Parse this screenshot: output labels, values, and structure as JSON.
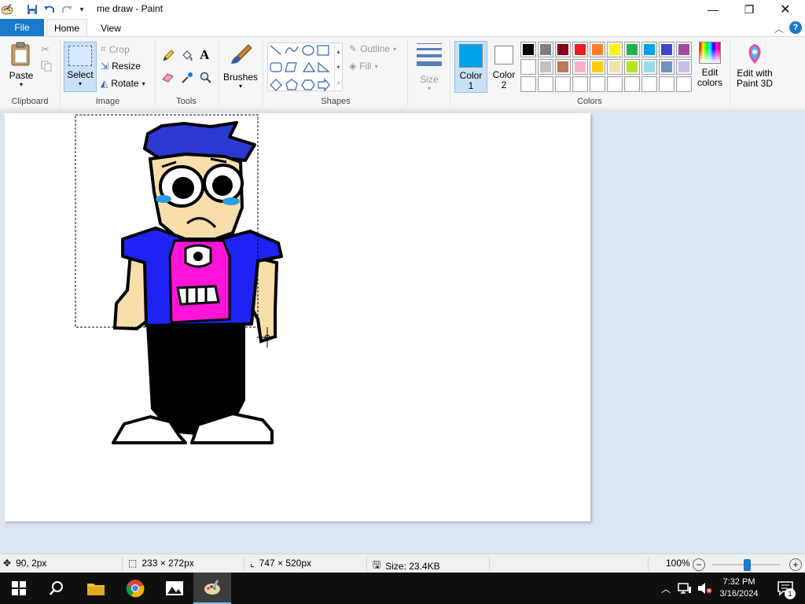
{
  "window": {
    "title": "me draw - Paint"
  },
  "menu": {
    "file": "File",
    "home": "Home",
    "view": "View"
  },
  "clipboard": {
    "paste": "Paste",
    "label": "Clipboard"
  },
  "image": {
    "select": "Select",
    "crop": "Crop",
    "resize": "Resize",
    "rotate": "Rotate",
    "label": "Image"
  },
  "tools": {
    "label": "Tools"
  },
  "brushes": {
    "label": "Brushes"
  },
  "shapes": {
    "outline": "Outline",
    "fill": "Fill",
    "label": "Shapes"
  },
  "size": {
    "label": "Size"
  },
  "colors": {
    "color1_label": "Color",
    "color1_num": "1",
    "color2_label": "Color",
    "color2_num": "2",
    "color1_value": "#00a2e8",
    "color2_value": "#ffffff",
    "edit_colors_1": "Edit",
    "edit_colors_2": "colors",
    "paint3d_1": "Edit with",
    "paint3d_2": "Paint 3D",
    "label": "Colors",
    "palette_row1": [
      "#000000",
      "#7f7f7f",
      "#880015",
      "#ed1c24",
      "#ff7f27",
      "#fff200",
      "#22b14c",
      "#00a2e8",
      "#3f48cc",
      "#a349a4"
    ],
    "palette_row2": [
      "#ffffff",
      "#c3c3c3",
      "#b97a57",
      "#ffaec9",
      "#ffc90e",
      "#efe4b0",
      "#b5e61d",
      "#99d9ea",
      "#7092be",
      "#c8bfe7"
    ],
    "palette_row3": [
      "#ffffff",
      "#ffffff",
      "#ffffff",
      "#ffffff",
      "#ffffff",
      "#ffffff",
      "#ffffff",
      "#ffffff",
      "#ffffff",
      "#ffffff"
    ]
  },
  "status": {
    "cursor_pos": "90, 2px",
    "selection_size": "233 × 272px",
    "canvas_size": "747 × 520px",
    "file_size": "Size: 23.4KB",
    "zoom": "100%"
  },
  "taskbar": {
    "time": "7:32 PM",
    "date": "3/16/2024",
    "notif_count": "1"
  }
}
